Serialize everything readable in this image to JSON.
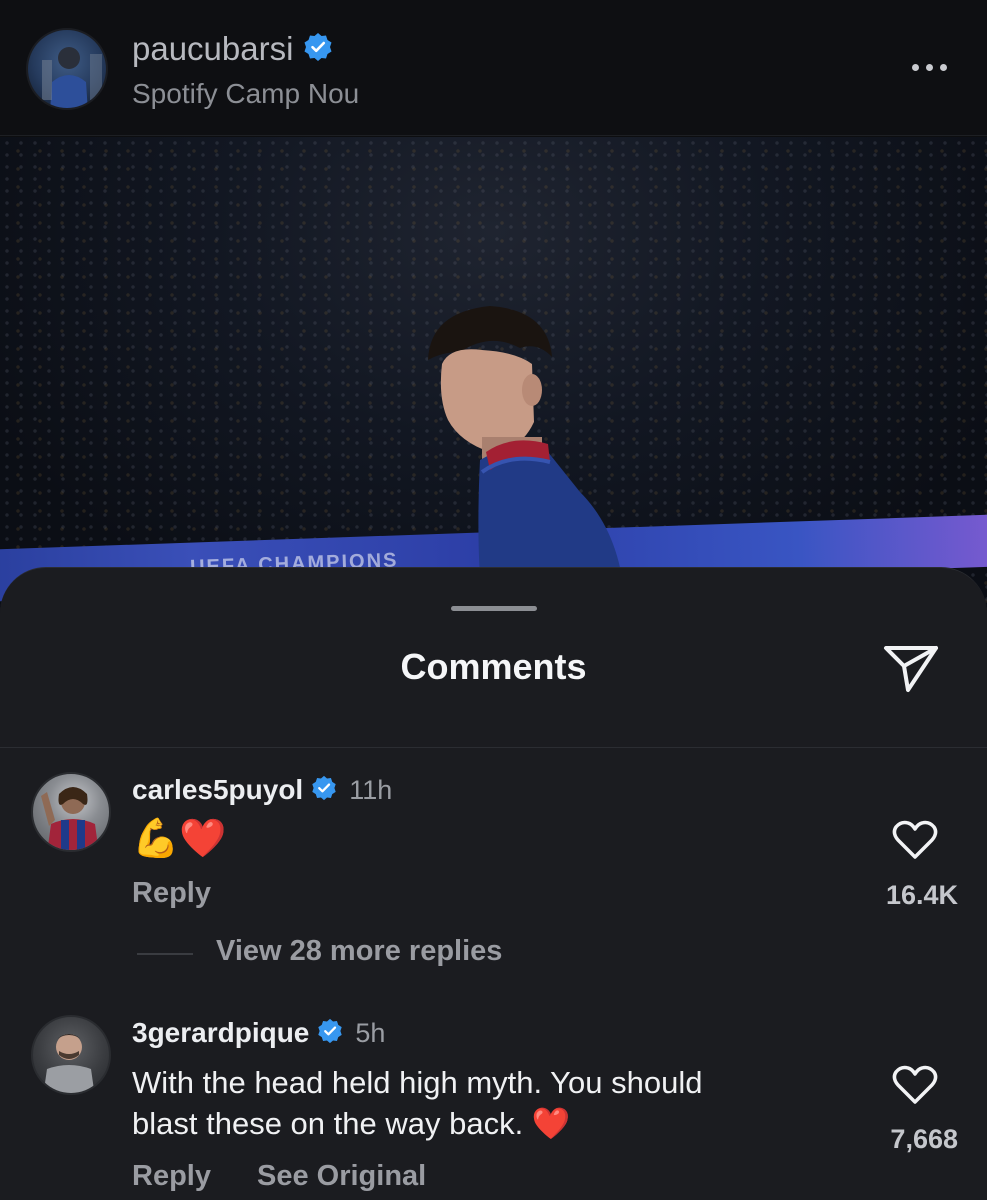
{
  "header": {
    "username": "paucubarsi",
    "location": "Spotify Camp Nou"
  },
  "post_image": {
    "banner_text": "UEFA CHAMPIONS"
  },
  "comments_sheet": {
    "title": "Comments",
    "comments": [
      {
        "username": "carles5puyol",
        "time": "11h",
        "text": "💪❤️",
        "reply_label": "Reply",
        "likes": "16.4K",
        "view_replies_label": "View 28 more replies"
      },
      {
        "username": "3gerardpique",
        "time": "5h",
        "text_line1": "With the head held high myth. You should",
        "text_line2": "blast these on the way back. ❤️",
        "reply_label": "Reply",
        "see_original_label": "See Original",
        "likes": "7,668"
      }
    ]
  },
  "colors": {
    "background": "#0d0e10",
    "sheet": "#1b1c20",
    "verified_badge": "#3797f0",
    "heart_emoji": "#e8242f"
  }
}
